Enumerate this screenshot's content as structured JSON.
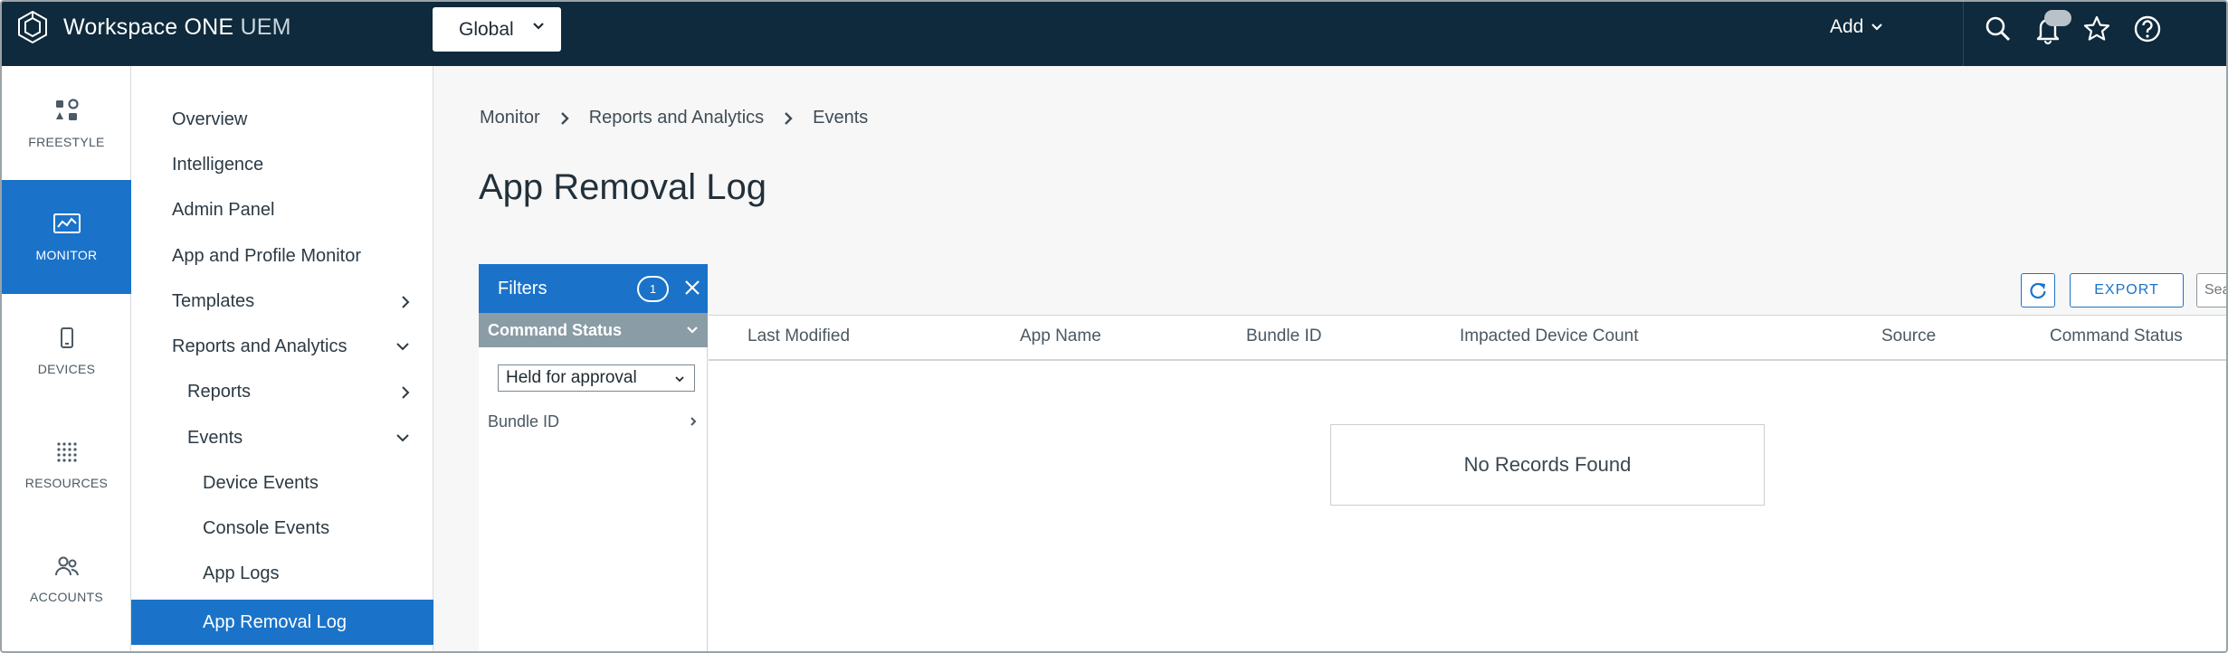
{
  "brand": {
    "name": "Workspace ONE",
    "suffix": "UEM"
  },
  "header": {
    "org_selector": "Global",
    "add_label": "Add",
    "icons": [
      "search-icon",
      "bell-icon",
      "star-icon",
      "help-icon"
    ]
  },
  "rail": {
    "items": [
      {
        "label": "FREESTYLE",
        "icon": "freestyle-icon",
        "active": false
      },
      {
        "label": "MONITOR",
        "icon": "monitor-icon",
        "active": true
      },
      {
        "label": "DEVICES",
        "icon": "device-icon",
        "active": false
      },
      {
        "label": "RESOURCES",
        "icon": "resources-icon",
        "active": false
      },
      {
        "label": "ACCOUNTS",
        "icon": "accounts-icon",
        "active": false
      }
    ]
  },
  "subnav": {
    "items": [
      {
        "label": "Overview"
      },
      {
        "label": "Intelligence"
      },
      {
        "label": "Admin Panel"
      },
      {
        "label": "App and Profile Monitor"
      },
      {
        "label": "Templates"
      },
      {
        "label": "Reports and Analytics"
      },
      {
        "label": "Reports"
      },
      {
        "label": "Events"
      },
      {
        "label": "Device Events"
      },
      {
        "label": "Console Events"
      },
      {
        "label": "App Logs"
      },
      {
        "label": "App Removal Log",
        "active": true
      }
    ]
  },
  "breadcrumb": [
    "Monitor",
    "Reports and Analytics",
    "Events"
  ],
  "page_title": "App Removal Log",
  "filters": {
    "title": "Filters",
    "count": "1",
    "group": "Command Status",
    "selected_value": "Held for approval",
    "bundle_label": "Bundle ID"
  },
  "toolbar": {
    "export_label": "EXPORT",
    "search_placeholder": "Search"
  },
  "grid": {
    "columns": [
      "Last Modified",
      "App Name",
      "Bundle ID",
      "Impacted Device Count",
      "Source",
      "Command Status"
    ],
    "empty_message": "No Records Found"
  },
  "colors": {
    "topbar": "#0e2a3c",
    "accent": "#1a73c9",
    "filter_group": "#8a9ca6"
  }
}
